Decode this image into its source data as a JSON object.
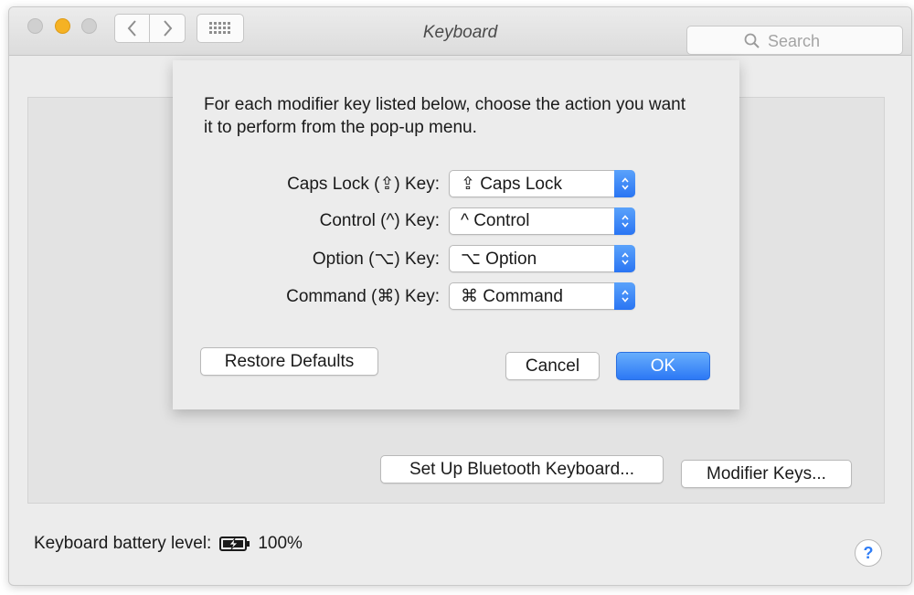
{
  "window": {
    "title": "Keyboard"
  },
  "toolbar": {
    "back_icon": "chevron-left-icon",
    "forward_icon": "chevron-right-icon",
    "grid_icon": "grid-icon",
    "search_placeholder": "Search"
  },
  "sheet": {
    "intro": "For each modifier key listed below, choose the action you want it to perform from the pop-up menu.",
    "rows": [
      {
        "label": "Caps Lock (⇪) Key:",
        "value": "⇪ Caps Lock"
      },
      {
        "label": "Control (^) Key:",
        "value": "^ Control"
      },
      {
        "label": "Option (⌥) Key:",
        "value": "⌥ Option"
      },
      {
        "label": "Command (⌘) Key:",
        "value": "⌘ Command"
      }
    ],
    "restore_label": "Restore Defaults",
    "cancel_label": "Cancel",
    "ok_label": "OK"
  },
  "main": {
    "bluetooth_button": "Set Up Bluetooth Keyboard...",
    "modifier_button": "Modifier Keys...",
    "battery_label": "Keyboard battery level:",
    "battery_value": "100%",
    "battery_level": 1.0,
    "help_label": "?"
  },
  "colors": {
    "accent": "#2f7df6",
    "window_bg": "#ececec",
    "minimize": "#f5b224"
  }
}
